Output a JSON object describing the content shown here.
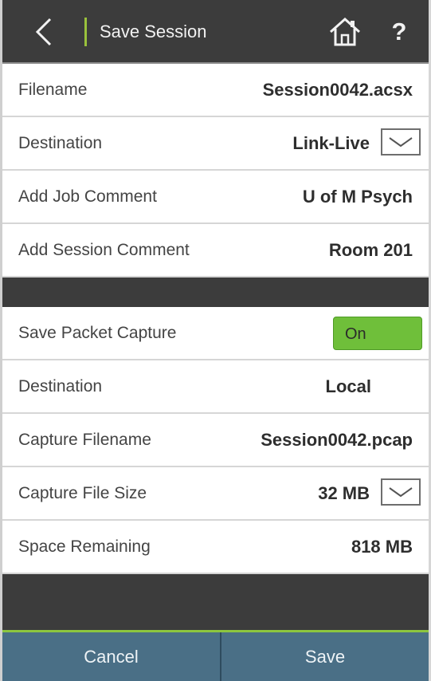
{
  "header": {
    "title": "Save Session",
    "help_label": "?"
  },
  "session": {
    "filename_label": "Filename",
    "filename_value": "Session0042.acsx",
    "destination_label": "Destination",
    "destination_value": "Link-Live",
    "job_comment_label": "Add Job Comment",
    "job_comment_value": "U of M Psych",
    "session_comment_label": "Add Session Comment",
    "session_comment_value": "Room 201"
  },
  "capture": {
    "save_packet_label": "Save Packet Capture",
    "save_packet_value": "On",
    "destination_label": "Destination",
    "destination_value": "Local",
    "filename_label": "Capture Filename",
    "filename_value": "Session0042.pcap",
    "file_size_label": "Capture File Size",
    "file_size_value": "32 MB",
    "space_label": "Space Remaining",
    "space_value": "818 MB"
  },
  "footer": {
    "cancel_label": "Cancel",
    "save_label": "Save"
  },
  "icons": {
    "back": "chevron-left-icon",
    "home": "home-icon",
    "help": "question-icon",
    "dropdown": "chevron-down-icon"
  },
  "colors": {
    "header_bg": "#3c3c3c",
    "accent_green": "#9ac23c",
    "toggle_on": "#6fbf3a",
    "footer_bg": "#4a6f86"
  }
}
